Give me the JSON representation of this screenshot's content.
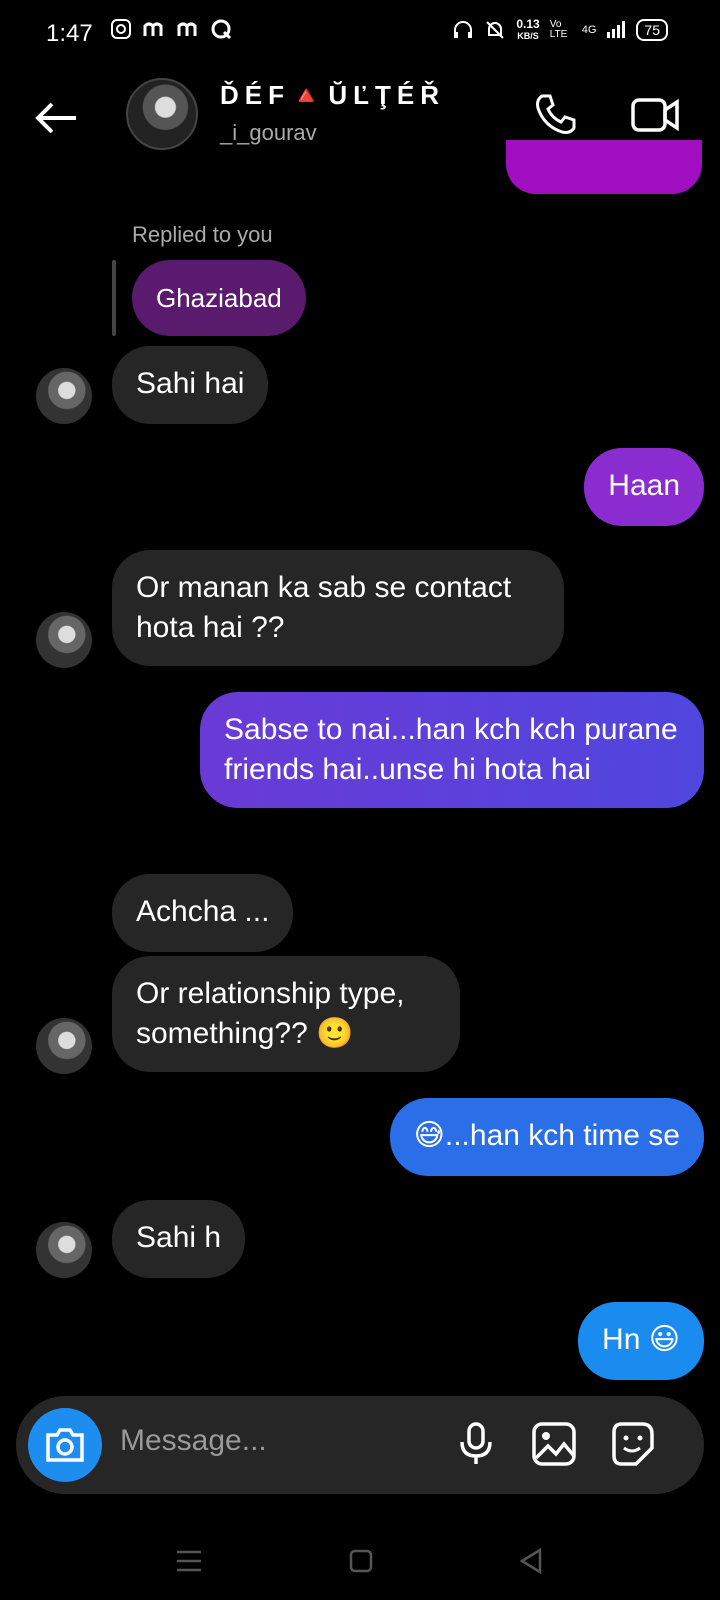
{
  "status": {
    "time": "1:47",
    "netspeed_value": "0.13",
    "netspeed_unit": "KB/S",
    "volte": "Vo LTE",
    "network": "4G",
    "battery": "75"
  },
  "header": {
    "name": "ĎÉF🔺ŬĽŢÉŘ",
    "handle": "_i_gourav"
  },
  "reply": {
    "label": "Replied to you",
    "quoted": "Ghaziabad"
  },
  "messages": [
    {
      "from": "them",
      "text": "Sahi hai"
    },
    {
      "from": "me",
      "text": "Haan"
    },
    {
      "from": "them",
      "text": "Or manan ka sab se contact hota hai ??"
    },
    {
      "from": "me",
      "text": "Sabse to nai...han kch kch purane friends hai..unse hi hota hai"
    },
    {
      "from": "them",
      "text": "Achcha ..."
    },
    {
      "from": "them",
      "text": "Or relationship type, something?? 🙂"
    },
    {
      "from": "me",
      "text": "😅...han kch time se"
    },
    {
      "from": "them",
      "text": "Sahi h"
    },
    {
      "from": "me",
      "text": "Hn 😃"
    }
  ],
  "composer": {
    "placeholder": "Message..."
  },
  "colors": {
    "incoming": "#262626",
    "outgoing_top": "#a10ec0",
    "outgoing_mid": "#6a3ad6",
    "outgoing_bottom": "#1a8cf0"
  }
}
